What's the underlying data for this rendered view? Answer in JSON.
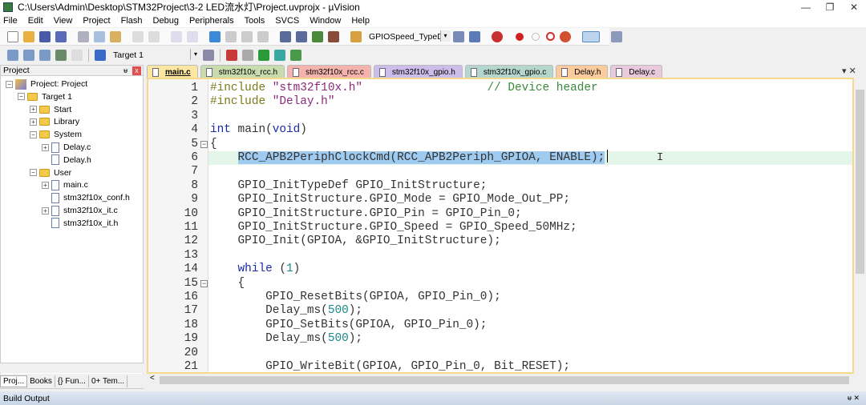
{
  "window": {
    "title": "C:\\Users\\Admin\\Desktop\\STM32Project\\3-2 LED流水灯\\Project.uvprojx - µVision",
    "minimize": "—",
    "maximize": "❐",
    "close": "✕"
  },
  "menu": [
    "File",
    "Edit",
    "View",
    "Project",
    "Flash",
    "Debug",
    "Peripherals",
    "Tools",
    "SVCS",
    "Window",
    "Help"
  ],
  "toolbar": {
    "find_combo": "GPIOSpeed_TypeDef",
    "target_combo": "Target 1"
  },
  "project_panel": {
    "title": "Project",
    "pin": "ᵾ",
    "close": "x",
    "tree": [
      {
        "label": "Project: Project",
        "level": 0,
        "toggle": "−",
        "icon": "project"
      },
      {
        "label": "Target 1",
        "level": 1,
        "toggle": "−",
        "icon": "folder"
      },
      {
        "label": "Start",
        "level": 2,
        "toggle": "+",
        "icon": "folder"
      },
      {
        "label": "Library",
        "level": 2,
        "toggle": "+",
        "icon": "folder"
      },
      {
        "label": "System",
        "level": 2,
        "toggle": "−",
        "icon": "folder"
      },
      {
        "label": "Delay.c",
        "level": 3,
        "toggle": "+",
        "icon": "file"
      },
      {
        "label": "Delay.h",
        "level": 3,
        "toggle": "",
        "icon": "file"
      },
      {
        "label": "User",
        "level": 2,
        "toggle": "−",
        "icon": "folder"
      },
      {
        "label": "main.c",
        "level": 3,
        "toggle": "+",
        "icon": "file"
      },
      {
        "label": "stm32f10x_conf.h",
        "level": 3,
        "toggle": "",
        "icon": "file"
      },
      {
        "label": "stm32f10x_it.c",
        "level": 3,
        "toggle": "+",
        "icon": "file"
      },
      {
        "label": "stm32f10x_it.h",
        "level": 3,
        "toggle": "",
        "icon": "file"
      }
    ],
    "bottom_tabs": [
      "Proj...",
      "Books",
      "{} Fun...",
      "0+ Tem..."
    ]
  },
  "editor_tabs": [
    {
      "label": "main.c",
      "color": "#fbe6a2",
      "active": true
    },
    {
      "label": "stm32f10x_rcc.h",
      "color": "#c9dcae"
    },
    {
      "label": "stm32f10x_rcc.c",
      "color": "#f5b3ae"
    },
    {
      "label": "stm32f10x_gpio.h",
      "color": "#cdbdea"
    },
    {
      "label": "stm32f10x_gpio.c",
      "color": "#b5d6cc"
    },
    {
      "label": "Delay.h",
      "color": "#fbcb9e"
    },
    {
      "label": "Delay.c",
      "color": "#e9c9dc"
    }
  ],
  "editor_controls": "▾ ✕",
  "code": [
    {
      "n": "1",
      "t": [
        [
          "pp",
          "#include"
        ],
        [
          "tx",
          " "
        ],
        [
          "str",
          "\"stm32f10x.h\""
        ],
        [
          "tx",
          "                  "
        ],
        [
          "cm",
          "// Device header"
        ]
      ]
    },
    {
      "n": "2",
      "t": [
        [
          "pp",
          "#include"
        ],
        [
          "tx",
          " "
        ],
        [
          "str",
          "\"Delay.h\""
        ]
      ]
    },
    {
      "n": "3",
      "t": []
    },
    {
      "n": "4",
      "t": [
        [
          "kw",
          "int"
        ],
        [
          "tx",
          " main("
        ],
        [
          "kw",
          "void"
        ],
        [
          "tx",
          ")"
        ]
      ]
    },
    {
      "n": "5",
      "fold": true,
      "t": [
        [
          "tx",
          "{"
        ]
      ]
    },
    {
      "n": "6",
      "current": true,
      "t": [
        [
          "tx",
          "    "
        ],
        [
          "sel",
          "RCC_APB2PeriphClockCmd(RCC_APB2Periph_GPIOA, ENABLE);"
        ]
      ]
    },
    {
      "n": "7",
      "t": []
    },
    {
      "n": "8",
      "t": [
        [
          "tx",
          "    GPIO_InitTypeDef GPIO_InitStructure;"
        ]
      ]
    },
    {
      "n": "9",
      "t": [
        [
          "tx",
          "    GPIO_InitStructure.GPIO_Mode = GPIO_Mode_Out_PP;"
        ]
      ]
    },
    {
      "n": "10",
      "t": [
        [
          "tx",
          "    GPIO_InitStructure.GPIO_Pin = GPIO_Pin_0;"
        ]
      ]
    },
    {
      "n": "11",
      "t": [
        [
          "tx",
          "    GPIO_InitStructure.GPIO_Speed = GPIO_Speed_50MHz;"
        ]
      ]
    },
    {
      "n": "12",
      "t": [
        [
          "tx",
          "    GPIO_Init(GPIOA, &GPIO_InitStructure);"
        ]
      ]
    },
    {
      "n": "13",
      "t": []
    },
    {
      "n": "14",
      "t": [
        [
          "tx",
          "    "
        ],
        [
          "kw",
          "while"
        ],
        [
          "tx",
          " ("
        ],
        [
          "num",
          "1"
        ],
        [
          "tx",
          ")"
        ]
      ]
    },
    {
      "n": "15",
      "fold": true,
      "t": [
        [
          "tx",
          "    {"
        ]
      ]
    },
    {
      "n": "16",
      "t": [
        [
          "tx",
          "        GPIO_ResetBits(GPIOA, GPIO_Pin_0);"
        ]
      ]
    },
    {
      "n": "17",
      "t": [
        [
          "tx",
          "        Delay_ms("
        ],
        [
          "num",
          "500"
        ],
        [
          "tx",
          ");"
        ]
      ]
    },
    {
      "n": "18",
      "t": [
        [
          "tx",
          "        GPIO_SetBits(GPIOA, GPIO_Pin_0);"
        ]
      ]
    },
    {
      "n": "19",
      "t": [
        [
          "tx",
          "        Delay_ms("
        ],
        [
          "num",
          "500"
        ],
        [
          "tx",
          ");"
        ]
      ]
    },
    {
      "n": "20",
      "t": []
    },
    {
      "n": "21",
      "t": [
        [
          "tx",
          "        GPIO_WriteBit(GPIOA, GPIO_Pin_0, Bit_RESET);"
        ]
      ]
    }
  ],
  "cursor_glyph": "I",
  "hscroll_left": "<",
  "build_output": {
    "title": "Build Output",
    "controls": "ᵾ ✕"
  }
}
